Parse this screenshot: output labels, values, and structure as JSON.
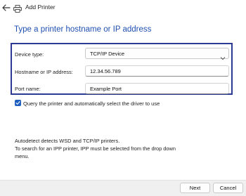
{
  "window": {
    "title": "Add Printer"
  },
  "heading": "Type a printer hostname or IP address",
  "form": {
    "device_type_label": "Device type:",
    "device_type_value": "TCP/IP Device",
    "hostname_label": "Hostname or IP address:",
    "hostname_value": "12.34.56.789",
    "port_label": "Port name:",
    "port_value": "Example Port"
  },
  "query_checkbox": {
    "label": "Query the printer and automatically select the driver to use",
    "checked": true
  },
  "info": {
    "line1": "Autodetect detects WSD and TCP/IP printers.",
    "line2": "To search for an IPP printer, IPP must be selected from the drop down",
    "line3": "menu."
  },
  "buttons": {
    "next": "Next",
    "cancel": "Cancel"
  },
  "colors": {
    "accent": "#1f4fb0",
    "highlight_border": "#2c3a94",
    "checkbox": "#1f5fbf"
  },
  "icons": {
    "back": "back-arrow-icon",
    "printer": "printer-icon",
    "chevron": "chevron-down-icon",
    "check": "checkmark-icon"
  }
}
